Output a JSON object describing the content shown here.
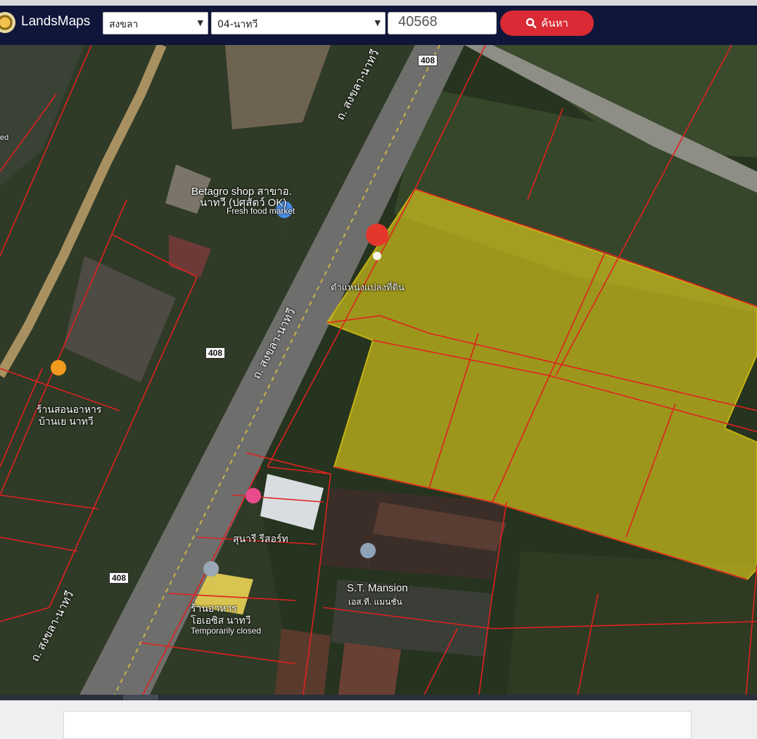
{
  "header": {
    "brand": "LandsMaps",
    "province": "สงขลา",
    "district": "04-นาทวี",
    "parcel_number": "40568",
    "search_label": "ค้นหา"
  },
  "map": {
    "road_label_1": "ถ. สงขลา-นาทวี",
    "road_label_2": "ถ. สงขลา-นาทวี",
    "road_label_3": "ถ. สงขลา-นาทวี",
    "route_shield": "408",
    "pin_label": "ตำแหน่งแปลงที่ดิน",
    "poi_betagro_name": "Betagro shop สาขาอ.",
    "poi_betagro_name2": "นาทวี (ปศุสัตว์ OK)",
    "poi_betagro_type": "Fresh food market",
    "poi_restaurant1_line1": "ร้านสอนอาหาร",
    "poi_restaurant1_line2": "บ้านเย นาทวี",
    "poi_resort": "สุนารี รีสอร์ท",
    "poi_mansion": "S.T. Mansion",
    "poi_mansion_th": "เอส.ที. แมนชั่น",
    "poi_restaurant2_line1": "ร้านอาหาร",
    "poi_restaurant2_line2": "โอเอซิส นาทวี",
    "poi_restaurant2_status": "Temporarily closed",
    "edge_text": "ed",
    "colors": {
      "highlight": "#e6d31c",
      "boundary": "#e0211f",
      "pin": "#e5362c"
    }
  }
}
